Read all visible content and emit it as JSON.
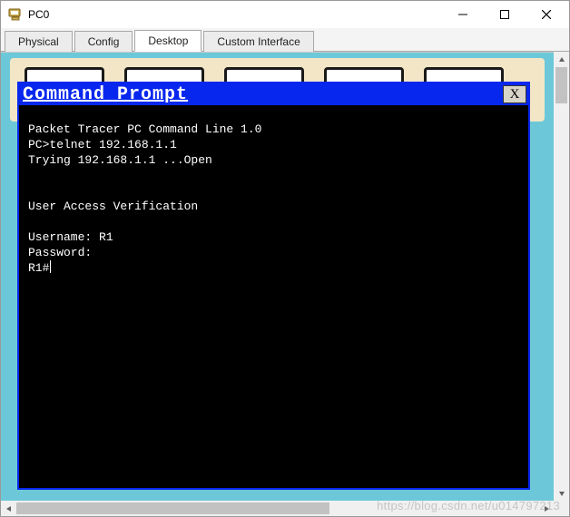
{
  "window": {
    "title": "PC0",
    "icon": "pc-icon"
  },
  "tabs": {
    "items": [
      {
        "label": "Physical",
        "active": false
      },
      {
        "label": "Config",
        "active": false
      },
      {
        "label": "Desktop",
        "active": true
      },
      {
        "label": "Custom Interface",
        "active": false
      }
    ]
  },
  "cmd": {
    "title": "Command Prompt",
    "close_label": "X",
    "lines": {
      "l0": "Packet Tracer PC Command Line 1.0",
      "l1": "PC>telnet 192.168.1.1",
      "l2": "Trying 192.168.1.1 ...Open",
      "l3": "",
      "l4": "",
      "l5": "User Access Verification",
      "l6": "",
      "l7": "Username: R1",
      "l8": "Password:",
      "l9": "R1#"
    }
  },
  "watermark": "https://blog.csdn.net/u014797213",
  "colors": {
    "cmd_title_bg": "#0827ee",
    "desktop_bg": "#6cc8d8",
    "sand": "#f2e6c6"
  }
}
